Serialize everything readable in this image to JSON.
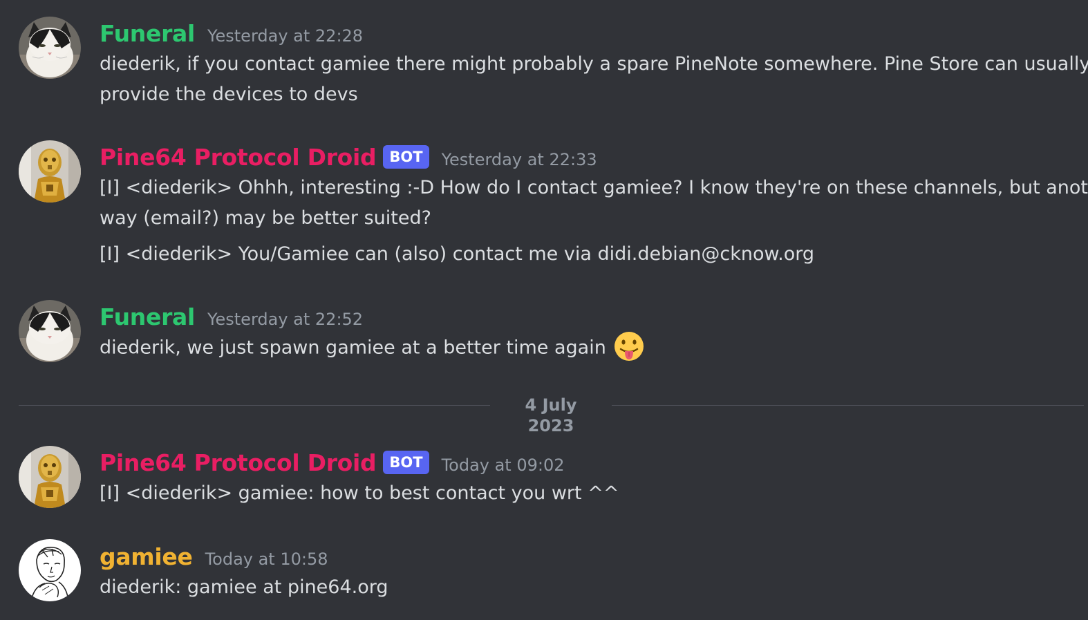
{
  "colors": {
    "background": "#313338",
    "text": "#dbdee1",
    "timestamp": "#949ba4",
    "funeral": "#2dc770",
    "droid": "#e91e63",
    "gamiee": "#f0b232",
    "bot_tag": "#5865f2"
  },
  "messages": [
    {
      "author": "Funeral",
      "avatar_icon": "cat-avatar",
      "bot": false,
      "timestamp": "Yesterday at 22:28",
      "lines": [
        "diederik, if you contact gamiee there might probably a spare PineNote somewhere. Pine Store can usually",
        "provide the devices to devs"
      ]
    },
    {
      "author": "Pine64 Protocol Droid",
      "avatar_icon": "droid-avatar",
      "bot": true,
      "bot_label": "BOT",
      "timestamp": "Yesterday at 22:33",
      "lines": [
        "[I] <diederik> Ohhh, interesting :-D How do I contact gamiee? I know they're on these channels, but another",
        "way (email?) may be better suited?",
        "[I] <diederik> You/Gamiee can (also) contact me via didi.debian@cknow.org"
      ]
    },
    {
      "author": "Funeral",
      "avatar_icon": "cat-avatar",
      "bot": false,
      "timestamp": "Yesterday at 22:52",
      "lines": [
        "diederik, we just spawn gamiee at a better time again"
      ],
      "emoji": "stuck-out-tongue-emoji"
    },
    {
      "author": "Pine64 Protocol Droid",
      "avatar_icon": "droid-avatar",
      "bot": true,
      "bot_label": "BOT",
      "timestamp": "Today at 09:02",
      "lines": [
        "[I] <diederik> gamiee: how to best contact you wrt ^^"
      ]
    },
    {
      "author": "gamiee",
      "avatar_icon": "sketch-avatar",
      "bot": false,
      "timestamp": "Today at 10:58",
      "lines": [
        "diederik: gamiee at pine64.org"
      ]
    }
  ],
  "date_divider": "4 July 2023"
}
